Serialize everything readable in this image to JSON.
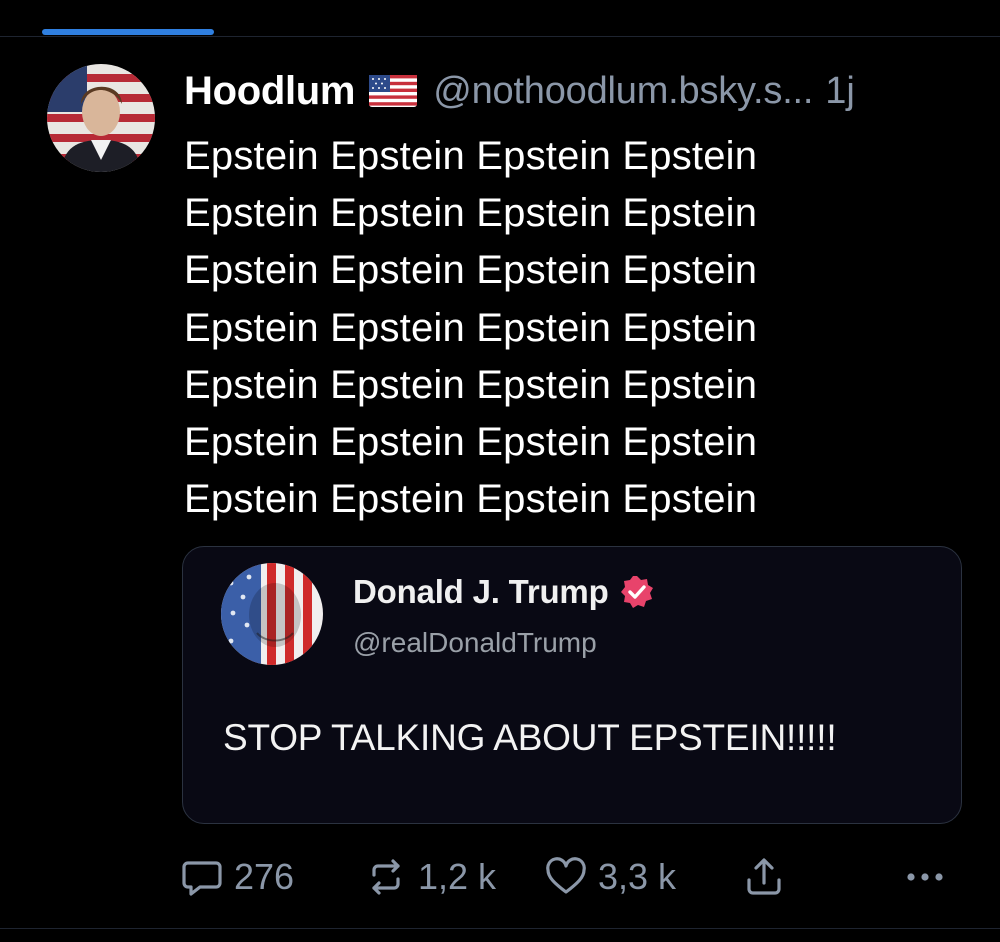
{
  "post": {
    "author_name": "Hoodlum",
    "author_flag": "us-flag-icon",
    "handle": "@nothoodlum.bsky.s...",
    "time": "1j",
    "text_lines": [
      "Epstein Epstein Epstein Epstein",
      "Epstein Epstein Epstein Epstein",
      "Epstein Epstein Epstein Epstein",
      "Epstein Epstein Epstein Epstein",
      "Epstein Epstein Epstein Epstein",
      "Epstein Epstein Epstein Epstein",
      "Epstein Epstein Epstein Epstein"
    ]
  },
  "quote": {
    "name": "Donald J. Trump",
    "verified": true,
    "handle": "@realDonaldTrump",
    "text": "STOP TALKING ABOUT EPSTEIN!!!!!"
  },
  "actions": {
    "replies": "276",
    "reposts": "1,2 k",
    "likes": "3,3 k"
  },
  "colors": {
    "background": "#000000",
    "accent": "#2f7fe0",
    "muted_text": "#8b97a8",
    "verified_badge": "#e8436b"
  }
}
